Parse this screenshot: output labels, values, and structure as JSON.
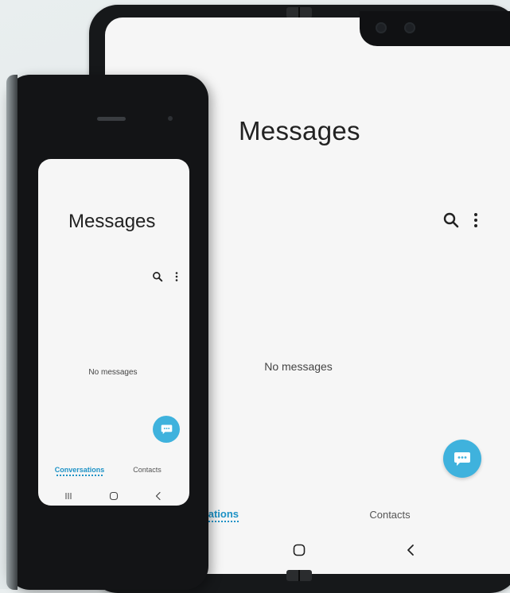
{
  "tablet": {
    "title": "Messages",
    "empty_text": "No messages",
    "tabs": [
      {
        "label": "sations",
        "active": true
      },
      {
        "label": "Contacts",
        "active": false
      }
    ],
    "icons": [
      "search-icon",
      "more-vert-icon",
      "compose-message-icon",
      "home-icon",
      "back-icon"
    ]
  },
  "phone": {
    "title": "Messages",
    "empty_text": "No messages",
    "tabs": [
      {
        "label": "Conversations",
        "active": true
      },
      {
        "label": "Contacts",
        "active": false
      }
    ],
    "icons": [
      "search-icon",
      "more-vert-icon",
      "compose-message-icon",
      "recents-icon",
      "home-icon",
      "back-icon"
    ]
  },
  "colors": {
    "accent": "#3fb2dd",
    "tab_active": "#1d92c6",
    "screen_bg": "#f6f6f6",
    "device_body": "#16181a"
  }
}
